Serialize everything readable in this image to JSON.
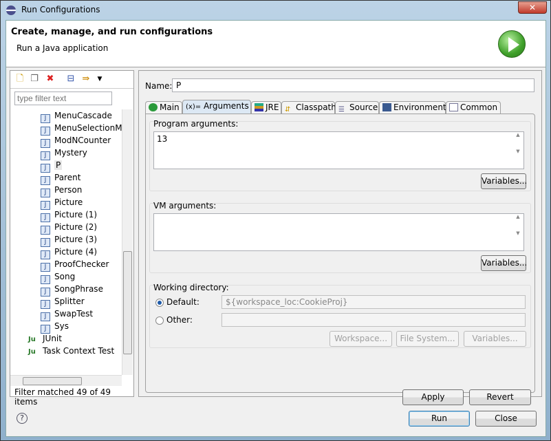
{
  "window": {
    "title": "Run Configurations",
    "close": "✕"
  },
  "header": {
    "title": "Create, manage, and run configurations",
    "subtitle": "Run a Java application"
  },
  "left": {
    "filter_placeholder": "type filter text",
    "matched": "Filter matched 49 of 49 items",
    "items": [
      {
        "label": "MenuCascade",
        "icon": "J"
      },
      {
        "label": "MenuSelectionM",
        "icon": "J"
      },
      {
        "label": "ModNCounter",
        "icon": "J"
      },
      {
        "label": "Mystery",
        "icon": "J"
      },
      {
        "label": "P",
        "icon": "J",
        "selected": true
      },
      {
        "label": "Parent",
        "icon": "J"
      },
      {
        "label": "Person",
        "icon": "J"
      },
      {
        "label": "Picture",
        "icon": "J"
      },
      {
        "label": "Picture (1)",
        "icon": "J"
      },
      {
        "label": "Picture (2)",
        "icon": "J"
      },
      {
        "label": "Picture (3)",
        "icon": "J"
      },
      {
        "label": "Picture (4)",
        "icon": "J"
      },
      {
        "label": "ProofChecker",
        "icon": "J"
      },
      {
        "label": "Song",
        "icon": "J"
      },
      {
        "label": "SongPhrase",
        "icon": "J"
      },
      {
        "label": "Splitter",
        "icon": "J"
      },
      {
        "label": "SwapTest",
        "icon": "J"
      },
      {
        "label": "Sys",
        "icon": "J"
      }
    ],
    "categories": [
      {
        "label": "JUnit",
        "icon": "Ju"
      },
      {
        "label": "Task Context Test",
        "icon": "Ju"
      }
    ]
  },
  "right": {
    "name_label": "Name:",
    "name_value": "P",
    "tabs": [
      "Main",
      "Arguments",
      "JRE",
      "Classpath",
      "Source",
      "Environment",
      "Common"
    ],
    "active_tab": "Arguments",
    "program_args_label": "Program arguments:",
    "program_args_value": "13",
    "vm_args_label": "VM arguments:",
    "vm_args_value": "",
    "variables": "Variables...",
    "working_dir_label": "Working directory:",
    "default_label": "Default:",
    "default_value": "${workspace_loc:CookieProj}",
    "other_label": "Other:",
    "other_value": "",
    "workspace": "Workspace...",
    "filesystem": "File System...",
    "apply": "Apply",
    "revert": "Revert"
  },
  "footer": {
    "help": "?",
    "run": "Run",
    "close": "Close"
  }
}
